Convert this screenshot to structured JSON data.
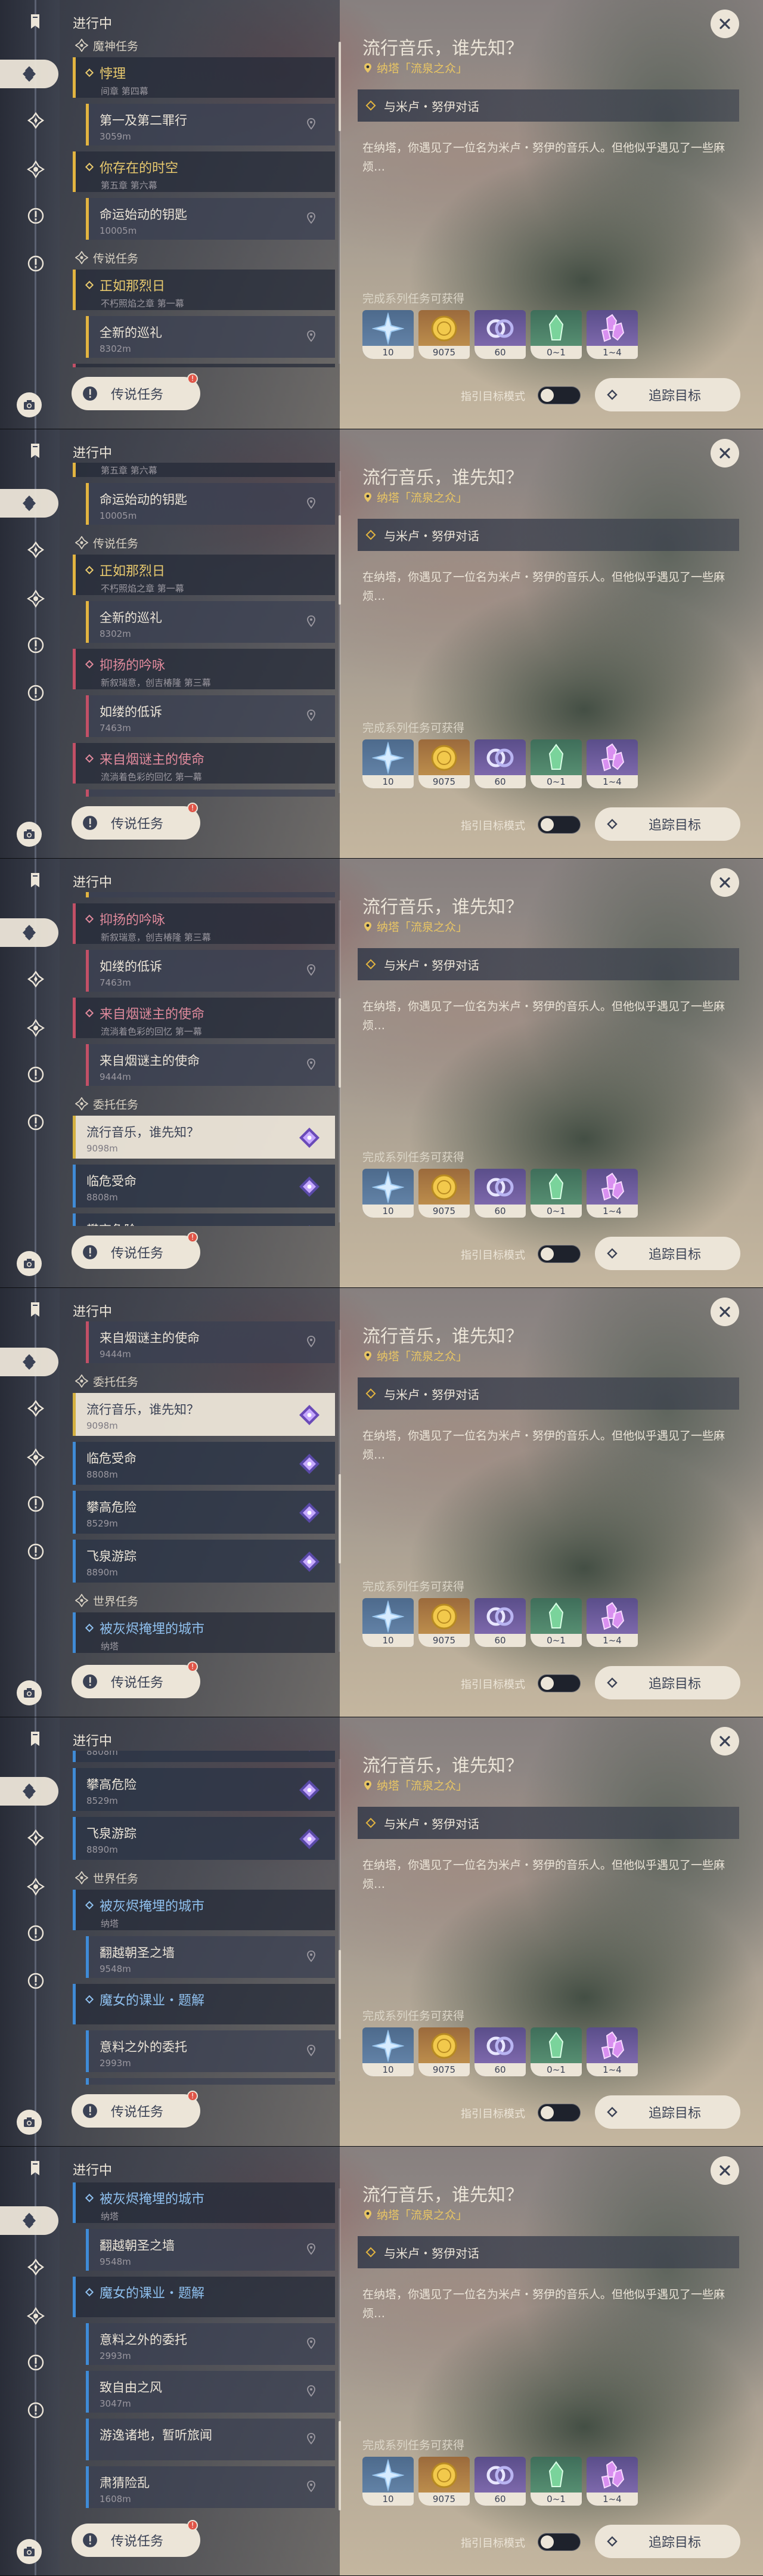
{
  "list_title": "进行中",
  "legend_button": "传说任务",
  "legend_badge": "!",
  "quest_detail": {
    "title": "流行音乐，谁先知？",
    "location": "纳塔「流泉之众」",
    "objective": "与米卢・努伊对话",
    "description": "在纳塔，你遇见了一位名为米卢・努伊的音乐人。但他似乎遇见了一些麻烦…",
    "rewards_label": "完成系列任务可获得",
    "rewards": [
      {
        "icon": "experience-star-icon",
        "count": "10"
      },
      {
        "icon": "mora-coin-icon",
        "count": "9075"
      },
      {
        "icon": "companionship-exp-icon",
        "count": "60"
      },
      {
        "icon": "green-crystal-icon",
        "count": "0~1"
      },
      {
        "icon": "purple-crystal-icon",
        "count": "1~4"
      }
    ]
  },
  "toggle_label": "指引目标模式",
  "track_button": "追踪目标",
  "colors": {
    "archon": "#e2b440",
    "story": "#c25066",
    "world": "#3f8bd6",
    "cream": "#ece5d8"
  },
  "sidebar_icons": [
    "all-quests-icon",
    "archon-quest-icon",
    "story-quest-icon",
    "commission-quest-icon",
    "world-quest-icon"
  ],
  "sections": {
    "archon": "魔神任务",
    "legend": "传说任务",
    "commission": "委托任务",
    "world": "世界任务"
  },
  "archon_quests": [
    {
      "title": "悖理",
      "subtitle": "间章 第四幕",
      "steps": [
        {
          "title": "第一及第二罪行",
          "distance": "3059m"
        }
      ]
    },
    {
      "title": "你存在的时空",
      "subtitle": "第五章 第六幕",
      "steps": [
        {
          "title": "命运始动的钥匙",
          "distance": "10005m"
        }
      ]
    }
  ],
  "legend_quests": [
    {
      "title": "正如那烈日",
      "subtitle": "不朽照焰之章 第一幕",
      "steps": [
        {
          "title": "全新的巡礼",
          "distance": "8302m"
        }
      ]
    },
    {
      "title": "抑扬的吟咏",
      "subtitle": "新叙瑞意，创吉椿隆 第三幕",
      "steps": [
        {
          "title": "如缕的低诉",
          "distance": "7463m"
        }
      ]
    },
    {
      "title": "来自烟谜主的使命",
      "subtitle": "流淌着色彩的回忆 第一幕",
      "steps": [
        {
          "title": "来自烟谜主的使命",
          "distance": "9444m"
        }
      ]
    }
  ],
  "commissions": [
    {
      "title": "流行音乐，谁先知？",
      "distance": "9098m"
    },
    {
      "title": "临危受命",
      "distance": "8808m"
    },
    {
      "title": "攀高危险",
      "distance": "8529m"
    },
    {
      "title": "飞泉游踪",
      "distance": "8890m"
    }
  ],
  "world_quests": [
    {
      "title": "被灰烬掩埋的城市",
      "subtitle": "纳塔",
      "steps": [
        {
          "title": "翻越朝圣之墙",
          "distance": "9548m"
        }
      ]
    },
    {
      "title": "魔女的课业・题解",
      "subtitle": "",
      "steps": [
        {
          "title": "意料之外的委托",
          "distance": "2993m"
        },
        {
          "title": "致自由之风",
          "distance": "3047m"
        },
        {
          "title": "游逸诸地，暂听旅闻",
          "distance": ""
        },
        {
          "title": "肃猜险乱",
          "distance": "1608m"
        }
      ]
    }
  ],
  "frames": [
    {
      "scroll": 0,
      "thumb": 0
    },
    {
      "scroll": 0.19,
      "thumb": 0.19
    },
    {
      "scroll": 0.42,
      "thumb": 0.42
    },
    {
      "scroll": 0.62,
      "thumb": 0.62
    },
    {
      "scroll": 0.82,
      "thumb": 0.82
    },
    {
      "scroll": 1,
      "thumb": 1
    }
  ]
}
